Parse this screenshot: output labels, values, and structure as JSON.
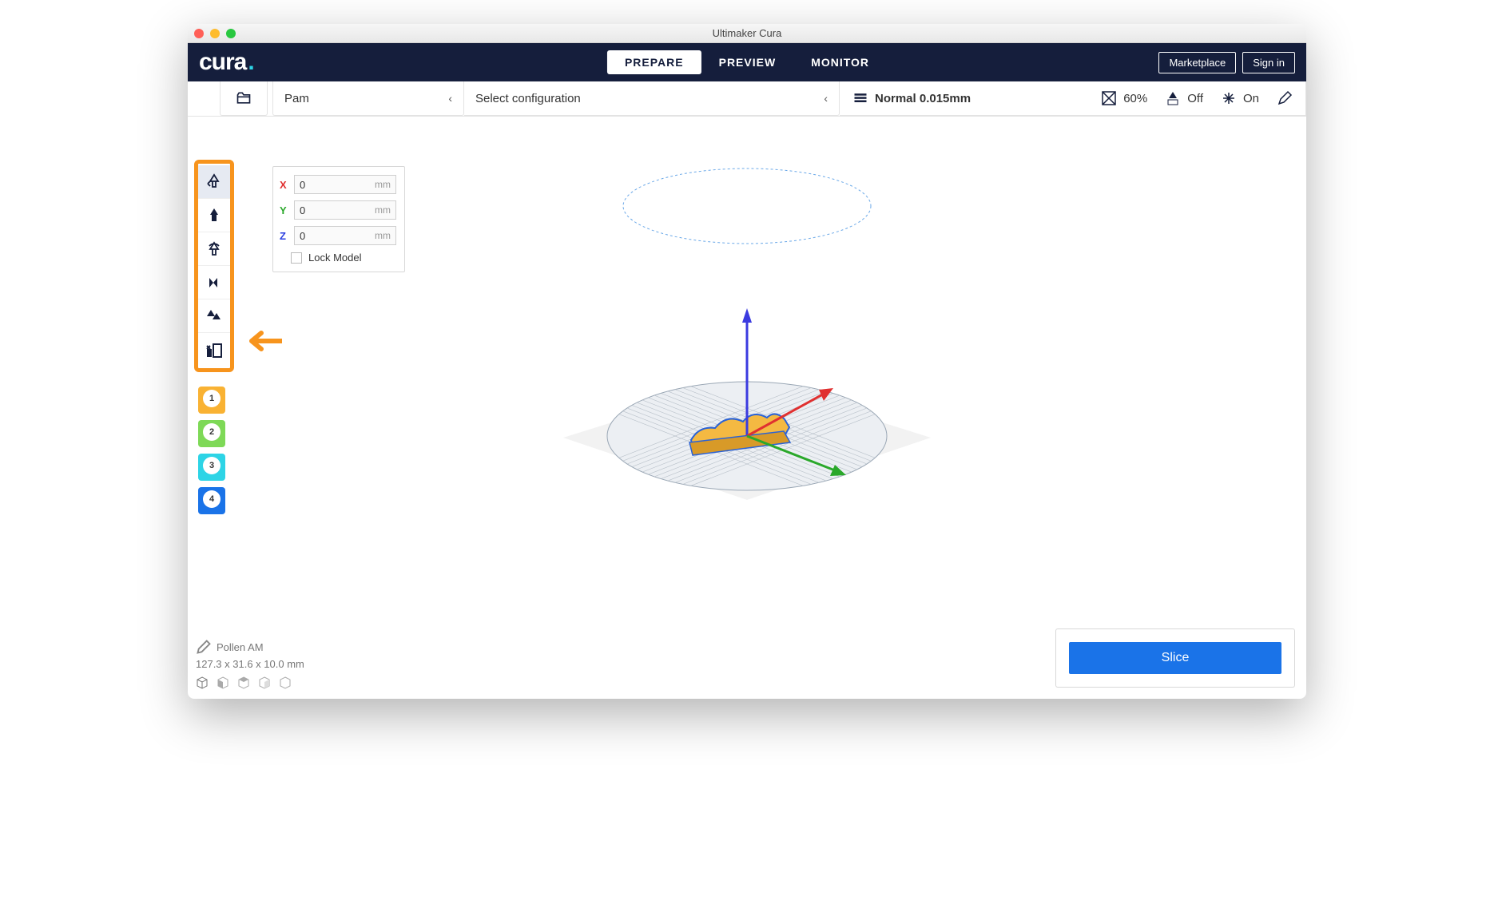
{
  "window": {
    "title": "Ultimaker Cura"
  },
  "logo": {
    "text": "cura",
    "dot": "."
  },
  "nav": {
    "tabs": [
      {
        "label": "PREPARE",
        "active": true
      },
      {
        "label": "PREVIEW",
        "active": false
      },
      {
        "label": "MONITOR",
        "active": false
      }
    ],
    "marketplace": "Marketplace",
    "signin": "Sign in"
  },
  "config": {
    "printer": "Pam",
    "configuration": "Select configuration",
    "profile": "Normal 0.015mm",
    "infill": "60%",
    "support": "Off",
    "adhesion": "On"
  },
  "move_panel": {
    "x": {
      "label": "X",
      "value": "0",
      "unit": "mm"
    },
    "y": {
      "label": "Y",
      "value": "0",
      "unit": "mm"
    },
    "z": {
      "label": "Z",
      "value": "0",
      "unit": "mm"
    },
    "lock_label": "Lock Model"
  },
  "extruders": [
    {
      "num": "1",
      "color": "#f9b233"
    },
    {
      "num": "2",
      "color": "#7ed957"
    },
    {
      "num": "3",
      "color": "#2dd4e6"
    },
    {
      "num": "4",
      "color": "#1a73e8"
    }
  ],
  "model_info": {
    "name": "Pollen AM",
    "dimensions": "127.3 x 31.6 x 10.0 mm"
  },
  "slice": {
    "label": "Slice"
  }
}
